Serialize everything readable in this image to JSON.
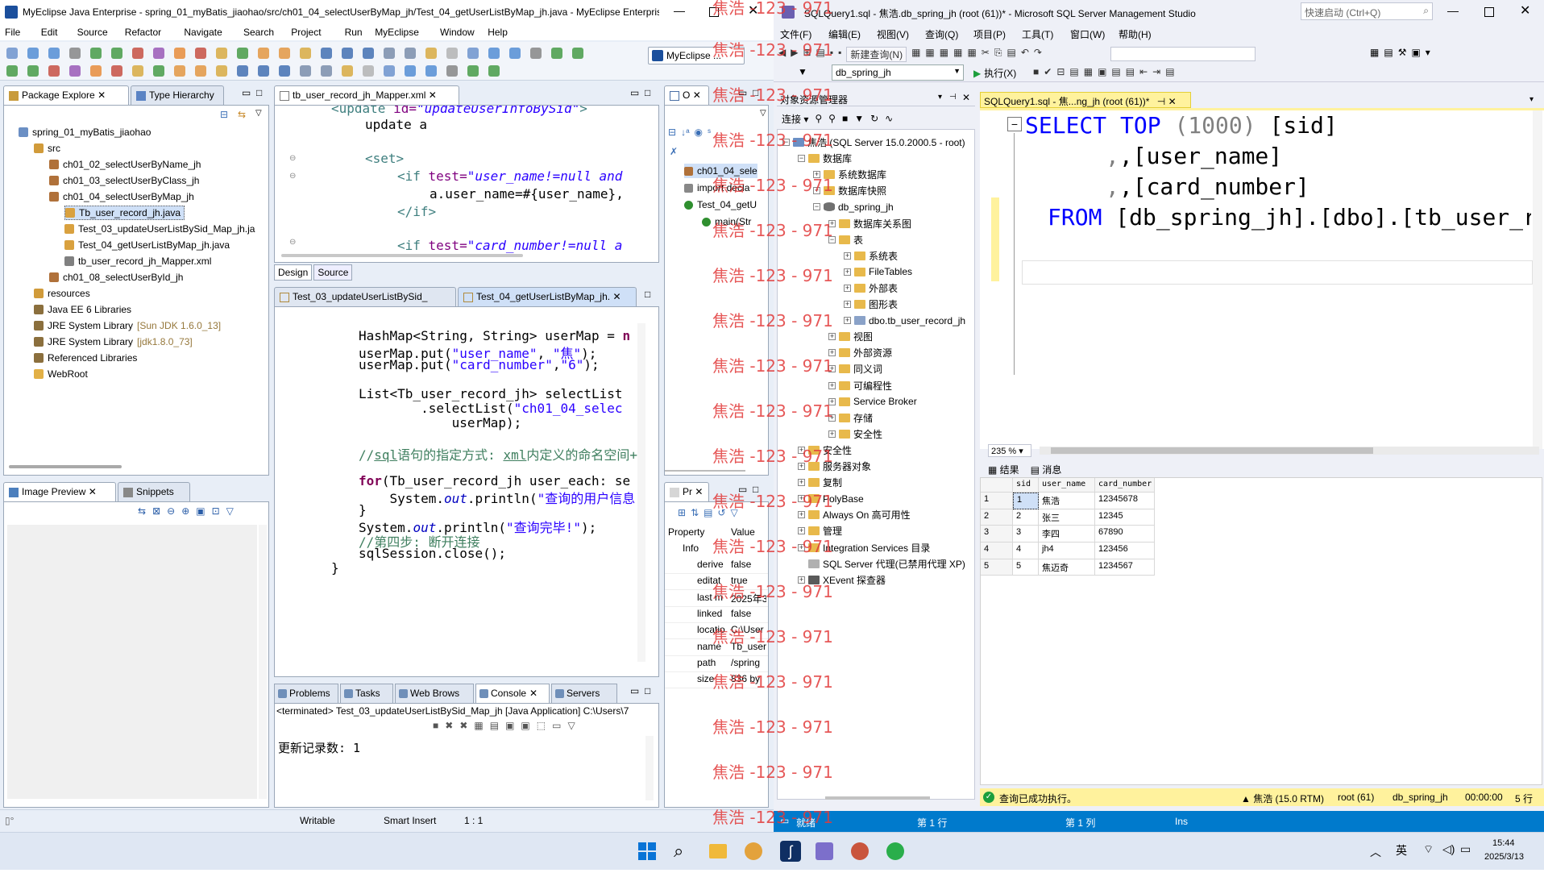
{
  "eclipse": {
    "title": "MyEclipse Java Enterprise - spring_01_myBatis_jiaohao/src/ch01_04_selectUserByMap_jh/Test_04_getUserListByMap_jh.java - MyEclipse Enterprise W...",
    "menu": [
      "File",
      "Edit",
      "Source",
      "Refactor",
      "Navigate",
      "Search",
      "Project",
      "Run",
      "MyEclipse",
      "Window",
      "Help"
    ],
    "perspective_label": "MyEclipse ...",
    "package_explorer": {
      "tab1": "Package Explore",
      "tab2": "Type Hierarchy",
      "items": [
        {
          "label": "spring_01_myBatis_jiaohao",
          "indent": 0,
          "kind": "project"
        },
        {
          "label": "src",
          "indent": 1,
          "kind": "srcfolder"
        },
        {
          "label": "ch01_02_selectUserByName_jh",
          "indent": 2,
          "kind": "package"
        },
        {
          "label": "ch01_03_selectUserByClass_jh",
          "indent": 2,
          "kind": "package"
        },
        {
          "label": "ch01_04_selectUserByMap_jh",
          "indent": 2,
          "kind": "package"
        },
        {
          "label": "Tb_user_record_jh.java",
          "indent": 3,
          "kind": "java",
          "selected": true
        },
        {
          "label": "Test_03_updateUserListBySid_Map_jh.ja",
          "indent": 3,
          "kind": "java"
        },
        {
          "label": "Test_04_getUserListByMap_jh.java",
          "indent": 3,
          "kind": "java"
        },
        {
          "label": "tb_user_record_jh_Mapper.xml",
          "indent": 3,
          "kind": "xml"
        },
        {
          "label": "ch01_08_selectUserById_jh",
          "indent": 2,
          "kind": "package"
        },
        {
          "label": "resources",
          "indent": 1,
          "kind": "srcfolder"
        },
        {
          "label": "Java EE 6 Libraries",
          "indent": 1,
          "kind": "lib"
        },
        {
          "label": "JRE System Library",
          "extra": "[Sun JDK 1.6.0_13]",
          "indent": 1,
          "kind": "lib"
        },
        {
          "label": "JRE System Library",
          "extra": "[jdk1.8.0_73]",
          "indent": 1,
          "kind": "lib"
        },
        {
          "label": "Referenced Libraries",
          "indent": 1,
          "kind": "lib"
        },
        {
          "label": "WebRoot",
          "indent": 1,
          "kind": "folder"
        }
      ]
    },
    "image_preview": {
      "tab1": "Image Preview",
      "tab2": "Snippets"
    },
    "xml_editor": {
      "tab": "tb_user_record_jh_Mapper.xml",
      "design_tab": "Design",
      "source_tab": "Source",
      "lines": [
        {
          "text": "<update id=\"updateUserInfoBySid\">",
          "y": 0
        },
        {
          "text": "update a",
          "y": 1
        },
        {
          "text": "<set>",
          "y": 3
        },
        {
          "text": "<if test=\"user_name!=null and",
          "y": 4
        },
        {
          "text": "a.user_name=#{user_name},",
          "y": 5
        },
        {
          "text": "</if>",
          "y": 6
        },
        {
          "text": "<if test=\"card_number!=null a",
          "y": 8
        }
      ]
    },
    "java_editor": {
      "tab1": "Test_03_updateUserListBySid_",
      "tab2": "Test_04_getUserListByMap_jh.",
      "lines": [
        "HashMap<String, String> userMap = n",
        "userMap.put(\"user_name\", \"焦\");",
        "userMap.put(\"card_number\",\"6\");",
        "",
        "List<Tb_user_record_jh> selectList",
        "        .selectList(\"ch01_04_selec",
        "            userMap);",
        "",
        "//sql语句的指定方式: xml内定义的命名空间+",
        "",
        "for(Tb_user_record_jh user_each: se",
        "    System.out.println(\"查询的用户信息",
        "}",
        "System.out.println(\"查询完毕!\");",
        "//第四步: 断开连接",
        "sqlSession.close();",
        "}"
      ]
    },
    "outline": {
      "tab": "O",
      "items": [
        "ch01_04_sele",
        "import decla",
        "Test_04_getU",
        "main(Str"
      ]
    },
    "properties": {
      "tab": "Pr",
      "col1": "Property",
      "col2": "Value",
      "group": "Info",
      "rows": [
        {
          "k": "derive",
          "v": "false"
        },
        {
          "k": "editat",
          "v": "true"
        },
        {
          "k": "last m",
          "v": "2025年3"
        },
        {
          "k": "linked",
          "v": "false"
        },
        {
          "k": "locatio",
          "v": "C:\\User"
        },
        {
          "k": "name",
          "v": "Tb_user"
        },
        {
          "k": "path",
          "v": "/spring"
        },
        {
          "k": "size",
          "v": "836  by"
        }
      ]
    },
    "console": {
      "tabs": [
        "Problems",
        "Tasks",
        "Web Brows",
        "Console",
        "Servers"
      ],
      "terminated": "<terminated> Test_03_updateUserListBySid_Map_jh [Java Application] C:\\Users\\7",
      "output": "更新记录数: 1"
    },
    "statusbar": {
      "writable": "Writable",
      "insert": "Smart Insert",
      "pos": "1 : 1"
    }
  },
  "ssms": {
    "title": "SQLQuery1.sql - 焦浩.db_spring_jh (root (61))* - Microsoft SQL Server Management Studio",
    "quick_launch": "快速启动 (Ctrl+Q)",
    "menu": [
      "文件(F)",
      "编辑(E)",
      "视图(V)",
      "查询(Q)",
      "项目(P)",
      "工具(T)",
      "窗口(W)",
      "帮助(H)"
    ],
    "new_query": "新建查询(N)",
    "db_select": "db_spring_jh",
    "execute": "执行(X)",
    "object_explorer": {
      "title": "对象资源管理器",
      "connect": "连接",
      "items": [
        {
          "label": "焦浩 (SQL Server 15.0.2000.5 - root)",
          "indent": 0,
          "exp": "-",
          "kind": "server"
        },
        {
          "label": "数据库",
          "indent": 1,
          "exp": "-",
          "kind": "folder"
        },
        {
          "label": "系统数据库",
          "indent": 2,
          "exp": "+",
          "kind": "folder"
        },
        {
          "label": "数据库快照",
          "indent": 2,
          "exp": "+",
          "kind": "folder"
        },
        {
          "label": "db_spring_jh",
          "indent": 2,
          "exp": "-",
          "kind": "db"
        },
        {
          "label": "数据库关系图",
          "indent": 3,
          "exp": "+",
          "kind": "folder"
        },
        {
          "label": "表",
          "indent": 3,
          "exp": "-",
          "kind": "folder"
        },
        {
          "label": "系统表",
          "indent": 4,
          "exp": "+",
          "kind": "folder"
        },
        {
          "label": "FileTables",
          "indent": 4,
          "exp": "+",
          "kind": "folder"
        },
        {
          "label": "外部表",
          "indent": 4,
          "exp": "+",
          "kind": "folder"
        },
        {
          "label": "图形表",
          "indent": 4,
          "exp": "+",
          "kind": "folder"
        },
        {
          "label": "dbo.tb_user_record_jh",
          "indent": 4,
          "exp": "+",
          "kind": "table"
        },
        {
          "label": "视图",
          "indent": 3,
          "exp": "+",
          "kind": "folder"
        },
        {
          "label": "外部资源",
          "indent": 3,
          "exp": "+",
          "kind": "folder"
        },
        {
          "label": "同义词",
          "indent": 3,
          "exp": "+",
          "kind": "folder"
        },
        {
          "label": "可编程性",
          "indent": 3,
          "exp": "+",
          "kind": "folder"
        },
        {
          "label": "Service Broker",
          "indent": 3,
          "exp": "+",
          "kind": "folder"
        },
        {
          "label": "存储",
          "indent": 3,
          "exp": "+",
          "kind": "folder"
        },
        {
          "label": "安全性",
          "indent": 3,
          "exp": "+",
          "kind": "folder"
        },
        {
          "label": "安全性",
          "indent": 1,
          "exp": "+",
          "kind": "folder"
        },
        {
          "label": "服务器对象",
          "indent": 1,
          "exp": "+",
          "kind": "folder"
        },
        {
          "label": "复制",
          "indent": 1,
          "exp": "+",
          "kind": "folder"
        },
        {
          "label": "PolyBase",
          "indent": 1,
          "exp": "+",
          "kind": "folder"
        },
        {
          "label": "Always On 高可用性",
          "indent": 1,
          "exp": "+",
          "kind": "folder"
        },
        {
          "label": "管理",
          "indent": 1,
          "exp": "+",
          "kind": "folder"
        },
        {
          "label": "Integration Services 目录",
          "indent": 1,
          "exp": "+",
          "kind": "folder"
        },
        {
          "label": "SQL Server 代理(已禁用代理 XP)",
          "indent": 1,
          "exp": "",
          "kind": "agent"
        },
        {
          "label": "XEvent 探查器",
          "indent": 1,
          "exp": "+",
          "kind": "xevent"
        }
      ]
    },
    "query_tab": "SQLQuery1.sql - 焦...ng_jh (root (61))*",
    "sql": {
      "l1_kw1": "SELECT",
      "l1_kw2": "TOP",
      "l1_num": "(1000)",
      "l1_col": "[sid]",
      "l2": ",[user_name]",
      "l3": ",[card_number]",
      "l4_kw": "FROM",
      "l4_rest": "[db_spring_jh].[dbo].[tb_user_r"
    },
    "zoom": "235 %",
    "results_tab": "结果",
    "messages_tab": "消息",
    "grid": {
      "headers": [
        "sid",
        "user_name",
        "card_number"
      ],
      "rows": [
        [
          "1",
          "焦浩",
          "12345678"
        ],
        [
          "2",
          "张三",
          "12345"
        ],
        [
          "3",
          "李四",
          "67890"
        ],
        [
          "4",
          "jh4",
          "123456"
        ],
        [
          "5",
          "焦迈奇",
          "1234567"
        ]
      ]
    },
    "query_status": {
      "msg": "查询已成功执行。",
      "server": "焦浩 (15.0 RTM)",
      "user": "root (61)",
      "db": "db_spring_jh",
      "time": "00:00:00",
      "rows": "5 行"
    },
    "bottom_status": {
      "ready": "就绪",
      "line": "第 1 行",
      "col": "第 1 列",
      "ins": "Ins"
    }
  },
  "watermark_text": "焦浩 -123 - 971",
  "taskbar": {
    "lang": "英",
    "time": "15:44",
    "date": "2025/3/13"
  },
  "colors": {
    "ssms_blue": "#007acc",
    "ssms_yellow": "#fff29d",
    "eclipse_bg": "#e8eef7",
    "ssms_chrome": "#eef0f7"
  }
}
